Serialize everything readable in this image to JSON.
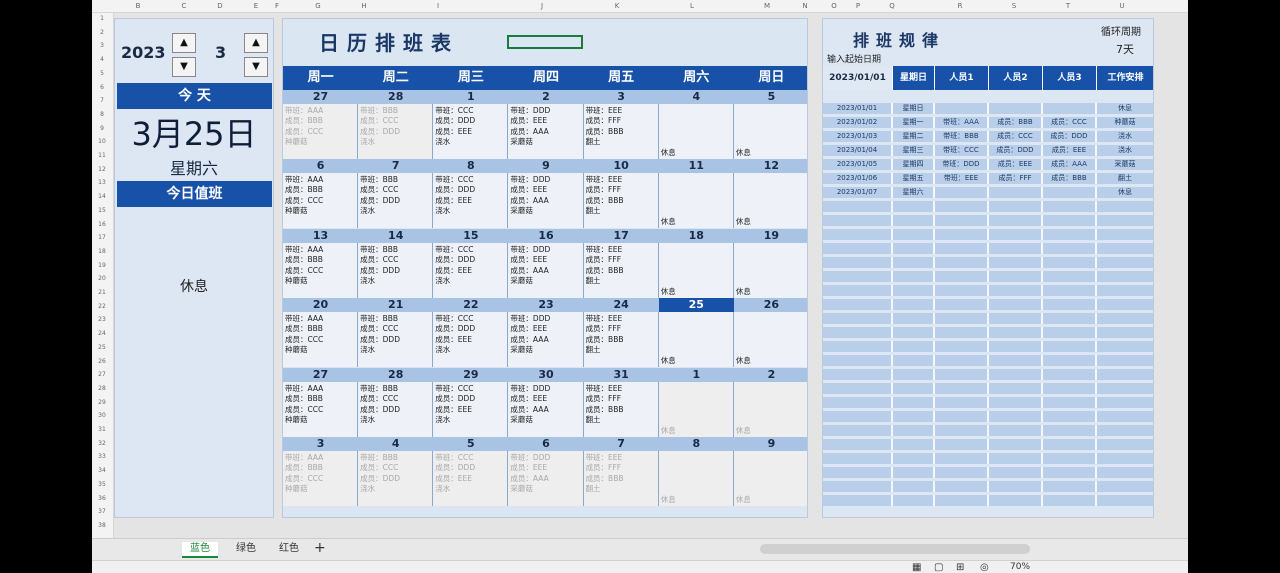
{
  "col_headers": [
    "B",
    "C",
    "D",
    "E",
    "F",
    "G",
    "H",
    "I",
    "J",
    "K",
    "L",
    "M",
    "N",
    "O",
    "P",
    "Q",
    "R",
    "S",
    "T",
    "U"
  ],
  "row_numbers": [
    "1",
    "2",
    "3",
    "4",
    "5",
    "6",
    "7",
    "8",
    "9",
    "10",
    "11",
    "12",
    "13",
    "14",
    "15",
    "16",
    "17",
    "18",
    "19",
    "20",
    "21",
    "22",
    "23",
    "24",
    "25",
    "26",
    "27",
    "28",
    "29",
    "30",
    "31",
    "32",
    "33",
    "34",
    "35",
    "36",
    "37",
    "38"
  ],
  "left": {
    "year": "2023",
    "month": "3",
    "today_label": "今 天",
    "date": "3月25日",
    "weekday": "星期六",
    "duty_label": "今日值班",
    "duty_value": "休息"
  },
  "calendar": {
    "title": "日历排班表",
    "weekdays": [
      "周一",
      "周二",
      "周三",
      "周四",
      "周五",
      "周六",
      "周日"
    ],
    "today": "25",
    "weeks": [
      {
        "days": [
          "27",
          "28",
          "1",
          "2",
          "3",
          "4",
          "5"
        ],
        "cells": [
          {
            "dim": true,
            "lines": [
              "带班：AAA",
              "成员：BBB",
              "成员：CCC",
              "种蘑菇"
            ]
          },
          {
            "dim": true,
            "lines": [
              "带班：BBB",
              "成员：CCC",
              "成员：DDD",
              "浇水"
            ]
          },
          {
            "dim": false,
            "lines": [
              "带班：CCC",
              "成员：DDD",
              "成员：EEE",
              "浇水"
            ]
          },
          {
            "dim": false,
            "lines": [
              "带班：DDD",
              "成员：EEE",
              "成员：AAA",
              "采蘑菇"
            ]
          },
          {
            "dim": false,
            "lines": [
              "带班：EEE",
              "成员：FFF",
              "成员：BBB",
              "翻土"
            ]
          },
          {
            "dim": false,
            "lines": [],
            "rest": "休息"
          },
          {
            "dim": false,
            "lines": [],
            "rest": "休息"
          }
        ]
      },
      {
        "days": [
          "6",
          "7",
          "8",
          "9",
          "10",
          "11",
          "12"
        ],
        "cells": [
          {
            "dim": false,
            "lines": [
              "带班：AAA",
              "成员：BBB",
              "成员：CCC",
              "种蘑菇"
            ]
          },
          {
            "dim": false,
            "lines": [
              "带班：BBB",
              "成员：CCC",
              "成员：DDD",
              "浇水"
            ]
          },
          {
            "dim": false,
            "lines": [
              "带班：CCC",
              "成员：DDD",
              "成员：EEE",
              "浇水"
            ]
          },
          {
            "dim": false,
            "lines": [
              "带班：DDD",
              "成员：EEE",
              "成员：AAA",
              "采蘑菇"
            ]
          },
          {
            "dim": false,
            "lines": [
              "带班：EEE",
              "成员：FFF",
              "成员：BBB",
              "翻土"
            ]
          },
          {
            "dim": false,
            "lines": [],
            "rest": "休息"
          },
          {
            "dim": false,
            "lines": [],
            "rest": "休息"
          }
        ]
      },
      {
        "days": [
          "13",
          "14",
          "15",
          "16",
          "17",
          "18",
          "19"
        ],
        "cells": [
          {
            "dim": false,
            "lines": [
              "带班：AAA",
              "成员：BBB",
              "成员：CCC",
              "种蘑菇"
            ]
          },
          {
            "dim": false,
            "lines": [
              "带班：BBB",
              "成员：CCC",
              "成员：DDD",
              "浇水"
            ]
          },
          {
            "dim": false,
            "lines": [
              "带班：CCC",
              "成员：DDD",
              "成员：EEE",
              "浇水"
            ]
          },
          {
            "dim": false,
            "lines": [
              "带班：DDD",
              "成员：EEE",
              "成员：AAA",
              "采蘑菇"
            ]
          },
          {
            "dim": false,
            "lines": [
              "带班：EEE",
              "成员：FFF",
              "成员：BBB",
              "翻土"
            ]
          },
          {
            "dim": false,
            "lines": [],
            "rest": "休息"
          },
          {
            "dim": false,
            "lines": [],
            "rest": "休息"
          }
        ]
      },
      {
        "days": [
          "20",
          "21",
          "22",
          "23",
          "24",
          "25",
          "26"
        ],
        "cells": [
          {
            "dim": false,
            "lines": [
              "带班：AAA",
              "成员：BBB",
              "成员：CCC",
              "种蘑菇"
            ]
          },
          {
            "dim": false,
            "lines": [
              "带班：BBB",
              "成员：CCC",
              "成员：DDD",
              "浇水"
            ]
          },
          {
            "dim": false,
            "lines": [
              "带班：CCC",
              "成员：DDD",
              "成员：EEE",
              "浇水"
            ]
          },
          {
            "dim": false,
            "lines": [
              "带班：DDD",
              "成员：EEE",
              "成员：AAA",
              "采蘑菇"
            ]
          },
          {
            "dim": false,
            "lines": [
              "带班：EEE",
              "成员：FFF",
              "成员：BBB",
              "翻土"
            ]
          },
          {
            "dim": false,
            "lines": [],
            "rest": "休息"
          },
          {
            "dim": false,
            "lines": [],
            "rest": "休息"
          }
        ]
      },
      {
        "days": [
          "27",
          "28",
          "29",
          "30",
          "31",
          "1",
          "2"
        ],
        "cells": [
          {
            "dim": false,
            "lines": [
              "带班：AAA",
              "成员：BBB",
              "成员：CCC",
              "种蘑菇"
            ]
          },
          {
            "dim": false,
            "lines": [
              "带班：BBB",
              "成员：CCC",
              "成员：DDD",
              "浇水"
            ]
          },
          {
            "dim": false,
            "lines": [
              "带班：CCC",
              "成员：DDD",
              "成员：EEE",
              "浇水"
            ]
          },
          {
            "dim": false,
            "lines": [
              "带班：DDD",
              "成员：EEE",
              "成员：AAA",
              "采蘑菇"
            ]
          },
          {
            "dim": false,
            "lines": [
              "带班：EEE",
              "成员：FFF",
              "成员：BBB",
              "翻土"
            ]
          },
          {
            "dim": true,
            "lines": [],
            "rest": "休息"
          },
          {
            "dim": true,
            "lines": [],
            "rest": "休息"
          }
        ]
      },
      {
        "days": [
          "3",
          "4",
          "5",
          "6",
          "7",
          "8",
          "9"
        ],
        "cells": [
          {
            "dim": true,
            "lines": [
              "带班：AAA",
              "成员：BBB",
              "成员：CCC",
              "种蘑菇"
            ]
          },
          {
            "dim": true,
            "lines": [
              "带班：BBB",
              "成员：CCC",
              "成员：DDD",
              "浇水"
            ]
          },
          {
            "dim": true,
            "lines": [
              "带班：CCC",
              "成员：DDD",
              "成员：EEE",
              "浇水"
            ]
          },
          {
            "dim": true,
            "lines": [
              "带班：DDD",
              "成员：EEE",
              "成员：AAA",
              "采蘑菇"
            ]
          },
          {
            "dim": true,
            "lines": [
              "带班：EEE",
              "成员：FFF",
              "成员：BBB",
              "翻土"
            ]
          },
          {
            "dim": true,
            "lines": [],
            "rest": "休息"
          },
          {
            "dim": true,
            "lines": [],
            "rest": "休息"
          }
        ]
      }
    ]
  },
  "rules": {
    "title": "排班规律",
    "cycle_label": "循环周期",
    "cycle_value": "7天",
    "start_label": "输入起始日期",
    "headers": [
      "2023/01/01",
      "星期日",
      "人员1",
      "人员2",
      "人员3",
      "工作安排"
    ],
    "rows": [
      [
        "2023/01/01",
        "星期日",
        "",
        "",
        "",
        "休息"
      ],
      [
        "2023/01/02",
        "星期一",
        "带班：AAA",
        "成员：BBB",
        "成员：CCC",
        "种蘑菇"
      ],
      [
        "2023/01/03",
        "星期二",
        "带班：BBB",
        "成员：CCC",
        "成员：DDD",
        "浇水"
      ],
      [
        "2023/01/04",
        "星期三",
        "带班：CCC",
        "成员：DDD",
        "成员：EEE",
        "浇水"
      ],
      [
        "2023/01/05",
        "星期四",
        "带班：DDD",
        "成员：EEE",
        "成员：AAA",
        "采蘑菇"
      ],
      [
        "2023/01/06",
        "星期五",
        "带班：EEE",
        "成员：FFF",
        "成员：BBB",
        "翻土"
      ],
      [
        "2023/01/07",
        "星期六",
        "",
        "",
        "",
        "休息"
      ]
    ]
  },
  "sheet_tabs": [
    "蓝色",
    "绿色",
    "红色"
  ],
  "add_tab": "+",
  "zoom": "70%",
  "colors": {
    "accent": "#1751a8",
    "day_row": "#a8c3e4",
    "panel_bg": "#dde7f3"
  }
}
